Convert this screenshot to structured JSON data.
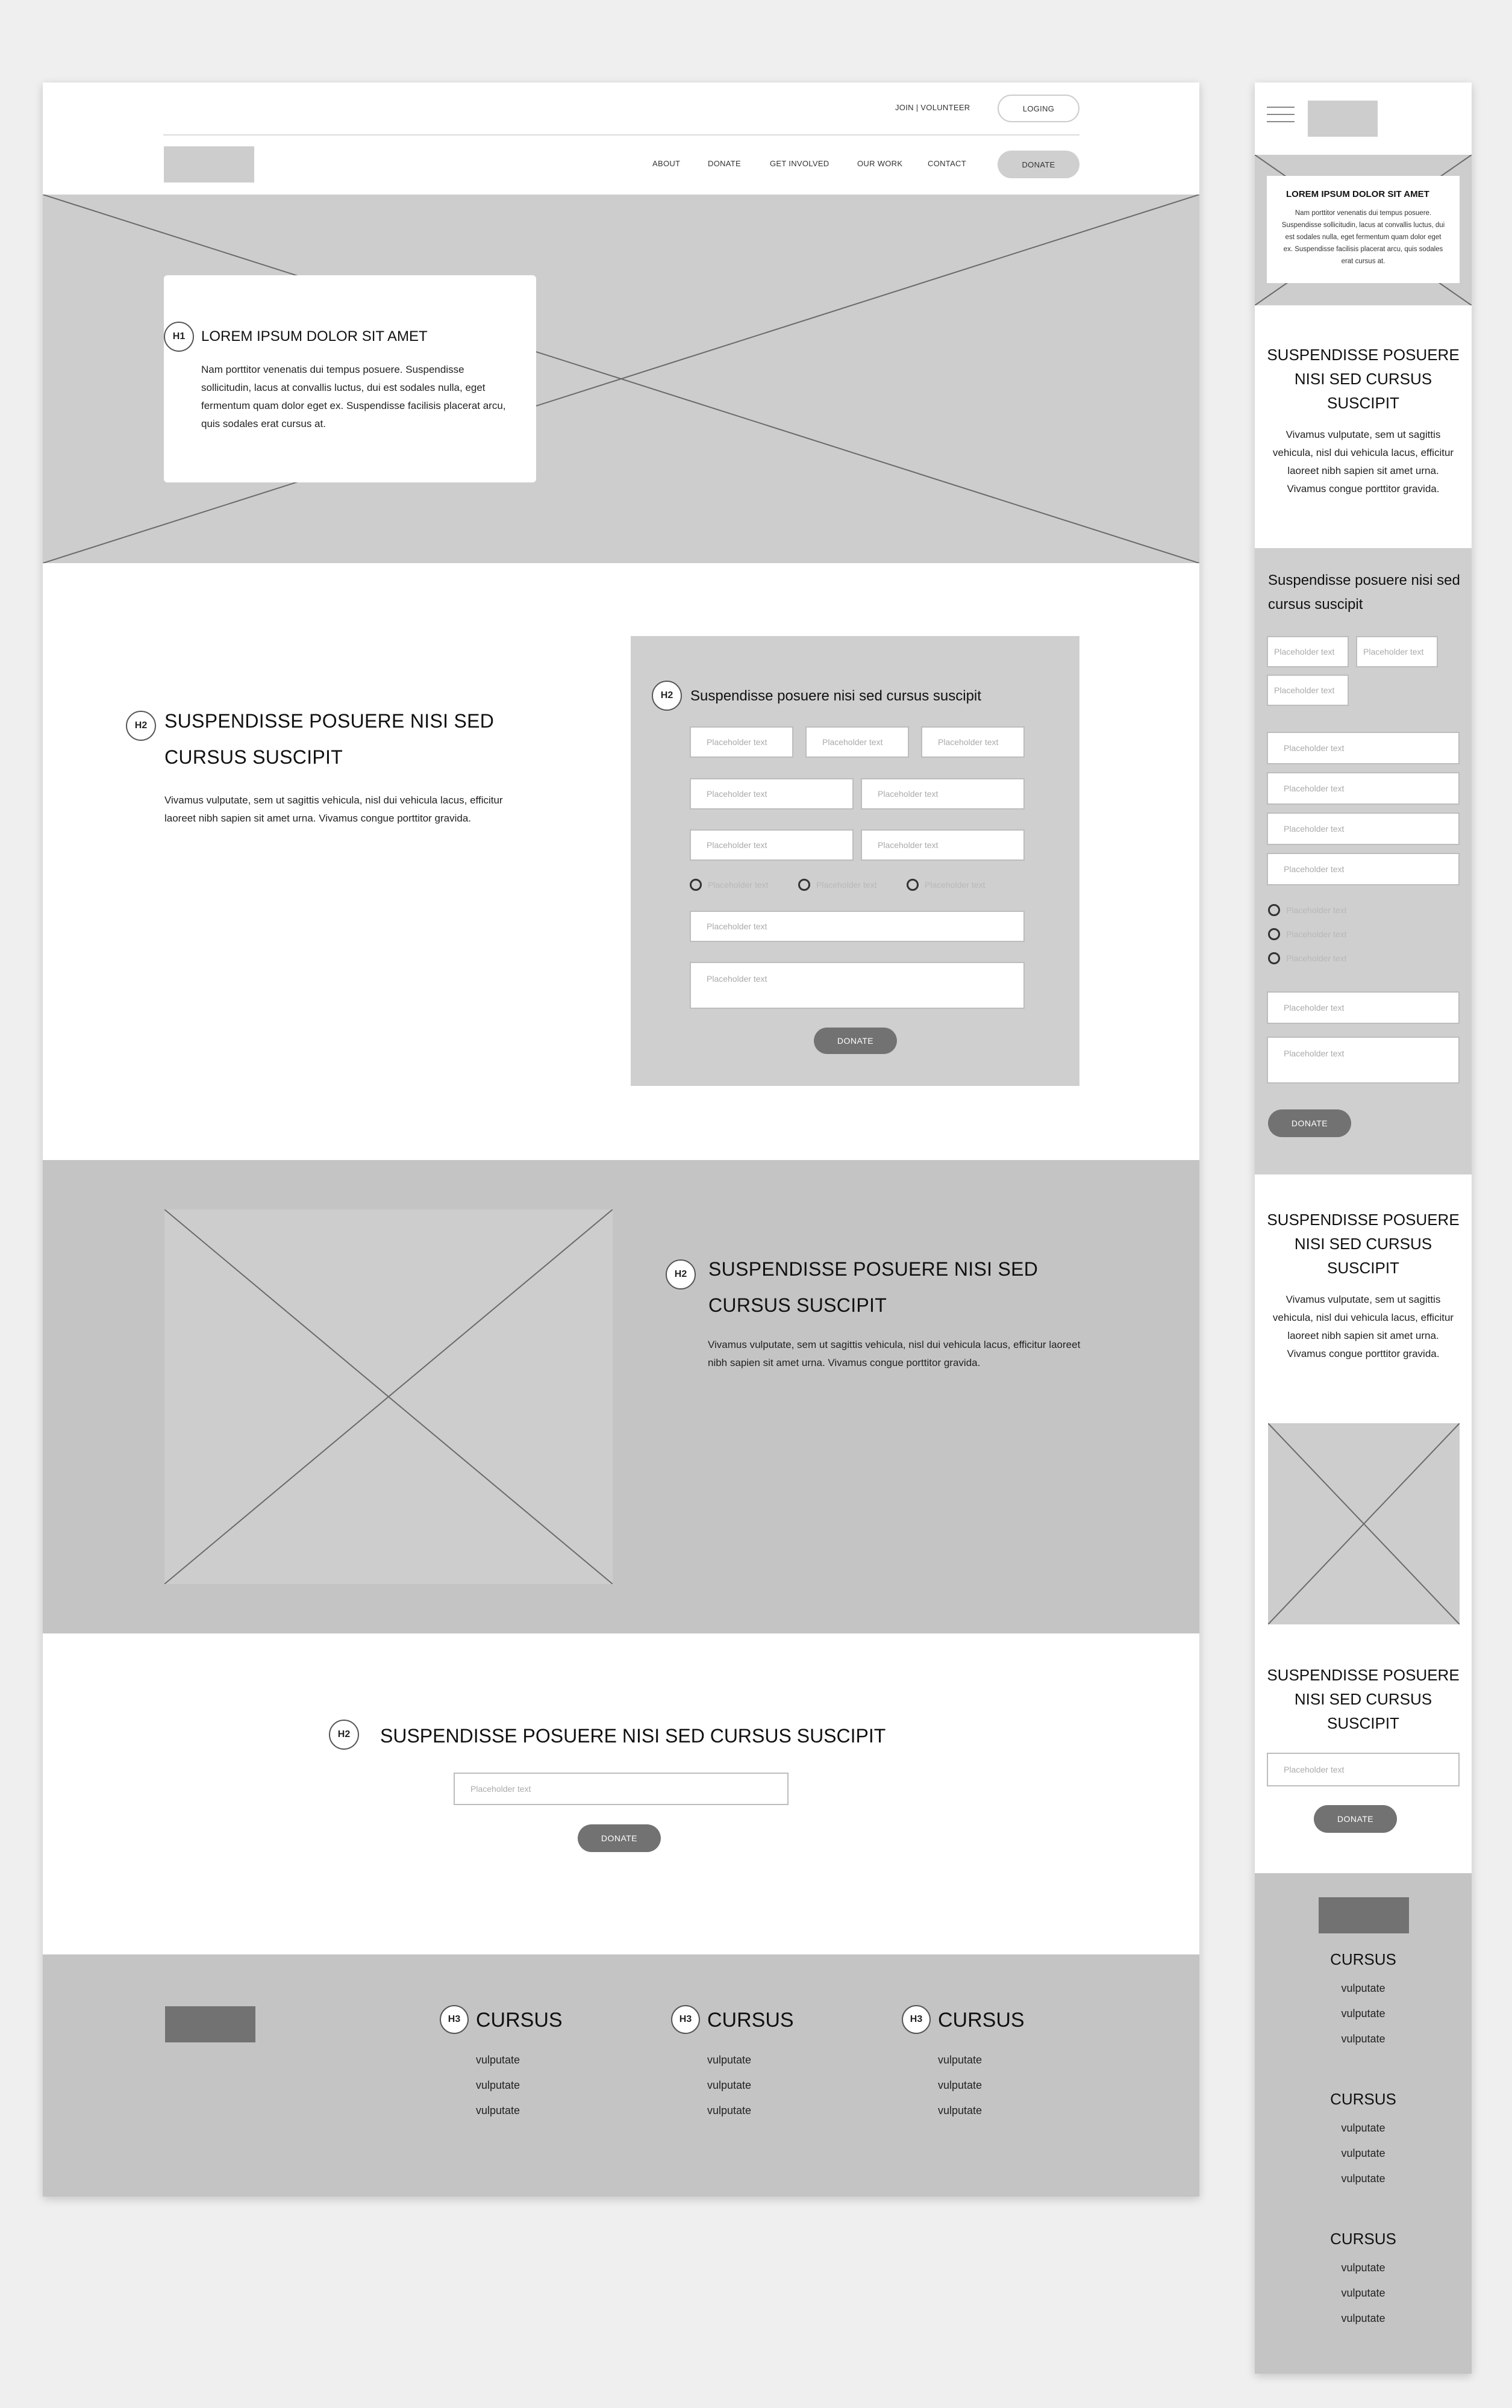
{
  "desktop": {
    "top_bar": {
      "join_label": "JOIN | VOLUNTEER",
      "login_label": "LOGING"
    },
    "nav": {
      "items": [
        "ABOUT",
        "DONATE",
        "GET INVOLVED",
        "OUR WORK",
        "CONTACT"
      ],
      "donate_label": "DONATE"
    },
    "hero": {
      "badge": "H1",
      "title": "LOREM IPSUM DOLOR SIT AMET",
      "text": "Nam porttitor venenatis dui tempus posuere. Suspendisse sollicitudin, lacus at convallis luctus, dui est sodales nulla, eget fermentum quam dolor eget ex. Suspendisse facilisis placerat arcu, quis sodales erat cursus at."
    },
    "form_section": {
      "badge": "H2",
      "title": "SUSPENDISSE POSUERE NISI SED CURSUS SUSCIPIT",
      "text": "Vivamus vulputate, sem ut sagittis vehicula, nisl dui vehicula lacus, efficitur laoreet nibh sapien sit amet urna. Vivamus congue porttitor gravida.",
      "form": {
        "badge": "H2",
        "title": "Suspendisse posuere nisi sed cursus suscipit",
        "placeholder": "Placeholder text",
        "radio_label": "Placeholder text",
        "donate_label": "DONATE"
      }
    },
    "image_section": {
      "badge": "H2",
      "title": "SUSPENDISSE POSUERE NISI SED CURSUS SUSCIPIT",
      "text": "Vivamus vulputate, sem ut sagittis vehicula, nisl dui vehicula lacus, efficitur laoreet nibh sapien sit amet urna. Vivamus congue porttitor gravida."
    },
    "cta_section": {
      "badge": "H2",
      "title": "SUSPENDISSE POSUERE NISI SED CURSUS SUSCIPIT",
      "placeholder": "Placeholder text",
      "donate_label": "DONATE"
    },
    "footer": {
      "columns": [
        {
          "badge": "H3",
          "title": "CURSUS",
          "links": [
            "vulputate",
            "vulputate",
            "vulputate"
          ]
        },
        {
          "badge": "H3",
          "title": "CURSUS",
          "links": [
            "vulputate",
            "vulputate",
            "vulputate"
          ]
        },
        {
          "badge": "H3",
          "title": "CURSUS",
          "links": [
            "vulputate",
            "vulputate",
            "vulputate"
          ]
        }
      ]
    }
  },
  "mobile": {
    "hero": {
      "title": "LOREM IPSUM DOLOR SIT AMET",
      "text": "Nam porttitor venenatis dui tempus posuere. Suspendisse sollicitudin, lacus at convallis luctus, dui est sodales nulla, eget fermentum quam dolor eget ex. Suspendisse facilisis placerat arcu, quis sodales erat cursus at."
    },
    "intro": {
      "title": "SUSPENDISSE POSUERE NISI SED CURSUS SUSCIPIT",
      "text": "Vivamus vulputate, sem ut sagittis vehicula, nisl dui vehicula lacus, efficitur laoreet nibh sapien sit amet urna. Vivamus congue porttitor gravida."
    },
    "form": {
      "title": "Suspendisse posuere nisi sed cursus suscipit",
      "placeholder": "Placeholder text",
      "radio_label": "Placeholder text",
      "donate_label": "DONATE"
    },
    "section2": {
      "title": "SUSPENDISSE POSUERE NISI SED CURSUS SUSCIPIT",
      "text": "Vivamus vulputate, sem ut sagittis vehicula, nisl dui vehicula lacus, efficitur laoreet nibh sapien sit amet urna. Vivamus congue porttitor gravida."
    },
    "cta": {
      "title": "SUSPENDISSE POSUERE NISI SED CURSUS SUSCIPIT",
      "placeholder": "Placeholder text",
      "donate_label": "DONATE"
    },
    "footer": {
      "columns": [
        {
          "title": "CURSUS",
          "links": [
            "vulputate",
            "vulputate",
            "vulputate"
          ]
        },
        {
          "title": "CURSUS",
          "links": [
            "vulputate",
            "vulputate",
            "vulputate"
          ]
        },
        {
          "title": "CURSUS",
          "links": [
            "vulputate",
            "vulputate",
            "vulputate"
          ]
        }
      ]
    }
  }
}
